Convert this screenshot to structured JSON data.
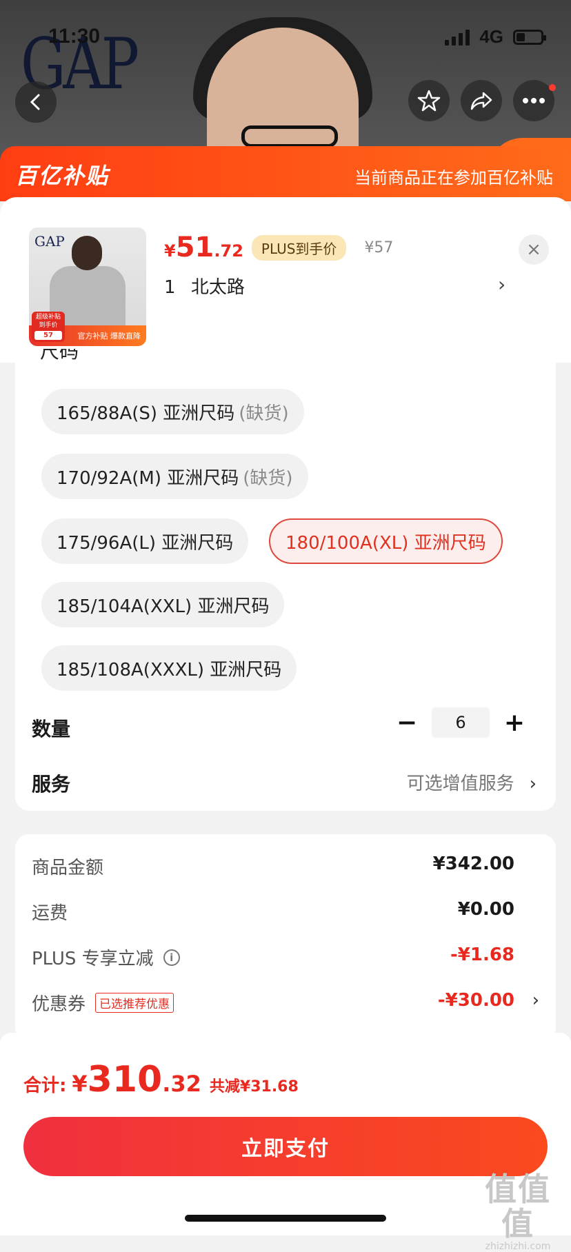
{
  "status_bar": {
    "time": "11:30",
    "network": "4G"
  },
  "hero": {
    "brand_logo": "GAP"
  },
  "nav": {
    "back_icon": "chevron-left-icon",
    "star_icon": "star-icon",
    "share_icon": "share-icon",
    "more_icon": "more-icon"
  },
  "banner": {
    "title": "百亿补贴",
    "note": "当前商品正在参加百亿补贴"
  },
  "product": {
    "thumb_logo": "GAP",
    "thumb_badge_line1": "超级补贴",
    "thumb_badge_line2": "到手价",
    "thumb_badge_price": "57",
    "thumb_strip": "官方补贴 爆款直降",
    "price_currency": "¥",
    "price_int": "51",
    "price_dec": ".72",
    "plus_tag": "PLUS到手价",
    "original_price": "¥57",
    "address_count": "1",
    "address": "北太路",
    "chevron": "›",
    "close": "×"
  },
  "size_section": {
    "label": "尺码",
    "options": [
      {
        "label": "165/88A(S) 亚洲尺码",
        "status": "(缺货)",
        "selected": false
      },
      {
        "label": "170/92A(M) 亚洲尺码",
        "status": "(缺货)",
        "selected": false
      },
      {
        "label": "175/96A(L) 亚洲尺码",
        "status": "",
        "selected": false
      },
      {
        "label": "180/100A(XL) 亚洲尺码",
        "status": "",
        "selected": true
      },
      {
        "label": "185/104A(XXL) 亚洲尺码",
        "status": "",
        "selected": false
      },
      {
        "label": "185/108A(XXXL) 亚洲尺码",
        "status": "",
        "selected": false
      }
    ]
  },
  "quantity": {
    "label": "数量",
    "minus": "−",
    "value": "6",
    "plus": "+"
  },
  "service": {
    "label": "服务",
    "value": "可选增值服务",
    "chevron": "›"
  },
  "fees": {
    "goods_label": "商品金额",
    "goods_value": "¥342.00",
    "shipping_label": "运费",
    "shipping_value": "¥0.00",
    "plus_label": "PLUS 专享立减",
    "plus_value": "-¥1.68",
    "info": "i",
    "coupon_label": "优惠券",
    "coupon_tag": "已选推荐优惠",
    "coupon_value": "-¥30.00",
    "coupon_chevron": "›"
  },
  "total": {
    "label": "合计:",
    "currency": "¥",
    "int": "310",
    "dec": ".32",
    "saved": "共减¥31.68"
  },
  "pay_button": "立即支付",
  "watermark": {
    "big": "值值值",
    "small": "zhizhizhi.com"
  },
  "colors": {
    "accent_red": "#e8291f",
    "banner_orange": "#ff6b1a",
    "plus_gold": "#fbe7b5"
  }
}
